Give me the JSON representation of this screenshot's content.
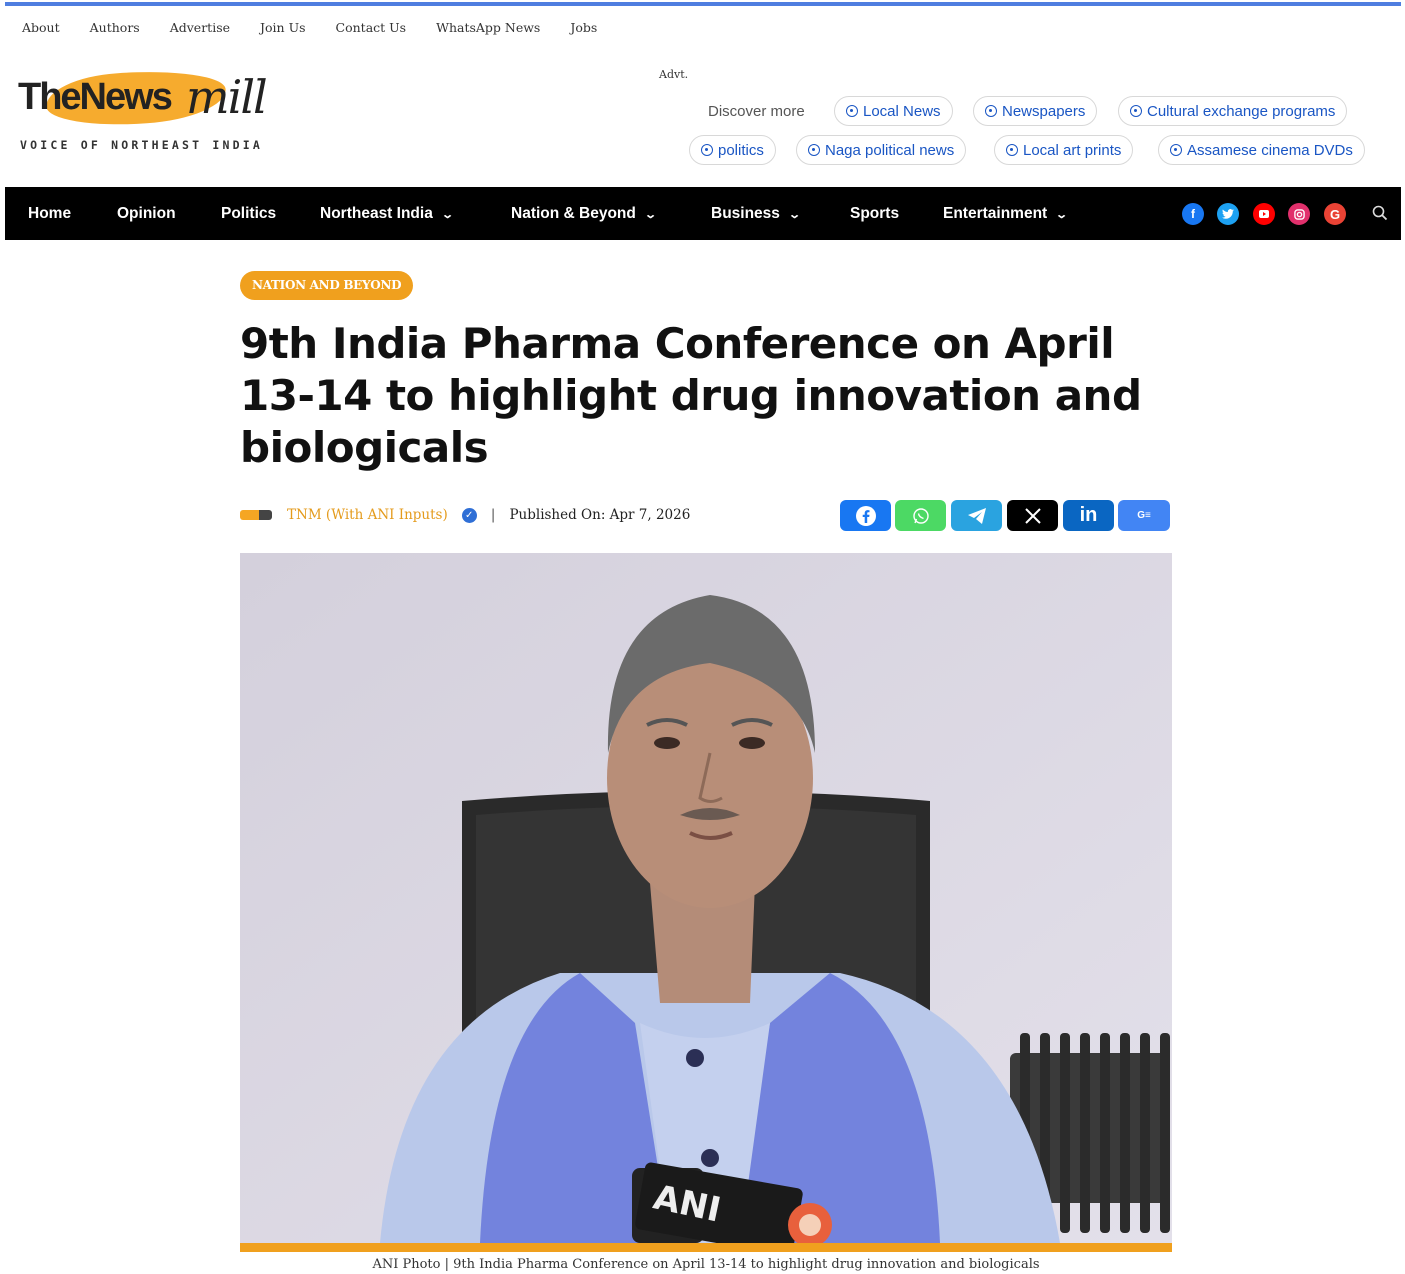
{
  "util_nav": [
    "About",
    "Authors",
    "Advertise",
    "Join Us",
    "Contact Us",
    "WhatsApp News",
    "Jobs"
  ],
  "logo": {
    "the_news": "TheNews",
    "mill": "mill",
    "tagline": "VOICE OF NORTHEAST INDIA"
  },
  "advt_label": "Advt.",
  "discover": {
    "label": "Discover more",
    "chips": [
      "Local News",
      "Newspapers",
      "Cultural exchange programs",
      "politics",
      "Naga political news",
      "Local art prints",
      "Assamese cinema DVDs"
    ]
  },
  "main_nav": {
    "items": [
      {
        "label": "Home",
        "dropdown": false
      },
      {
        "label": "Opinion",
        "dropdown": false
      },
      {
        "label": "Politics",
        "dropdown": false
      },
      {
        "label": "Northeast India",
        "dropdown": true
      },
      {
        "label": "Nation & Beyond",
        "dropdown": true
      },
      {
        "label": "Business",
        "dropdown": true
      },
      {
        "label": "Sports",
        "dropdown": false
      },
      {
        "label": "Entertainment",
        "dropdown": true
      }
    ],
    "social_icons": [
      "facebook-icon",
      "twitter-icon",
      "youtube-icon",
      "instagram-icon",
      "google-icon"
    ],
    "search_icon": "search-icon"
  },
  "article": {
    "category": "NATION AND BEYOND",
    "headline": "9th India Pharma Conference on April 13-14 to highlight drug innovation and biologicals",
    "author": "TNM (With ANI Inputs)",
    "separator": "|",
    "published": "Published On: Apr 7, 2026",
    "share_buttons": [
      "facebook-share",
      "whatsapp-share",
      "telegram-share",
      "x-share",
      "linkedin-share",
      "google-news-share"
    ],
    "photo_text": "ANI",
    "caption": "ANI Photo | 9th India Pharma Conference on April 13-14 to highlight drug innovation and biologicals"
  },
  "colors": {
    "accent_orange": "#f0a01e",
    "nav_bg": "#000000",
    "chip_blue": "#1a56c4",
    "top_accent": "#4f7ee0"
  }
}
